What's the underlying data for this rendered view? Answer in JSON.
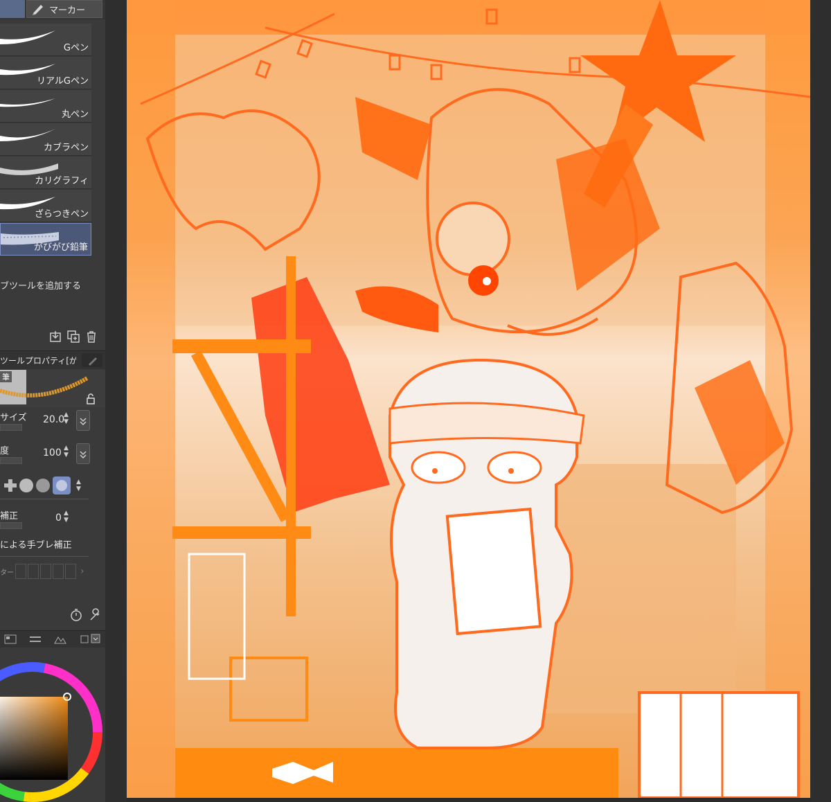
{
  "app": {
    "accent": "#7b8fc4"
  },
  "tabs": {
    "marker_label": "マーカー"
  },
  "brushes": [
    {
      "label": "Gペン",
      "stroke_color": "#ffffff"
    },
    {
      "label": "リアルGペン",
      "stroke_color": "#ffffff"
    },
    {
      "label": "丸ペン",
      "stroke_color": "#ffffff"
    },
    {
      "label": "カブラペン",
      "stroke_color": "#ffffff"
    },
    {
      "label": "カリグラフィ",
      "stroke_color": "#d0d0d0"
    },
    {
      "label": "ざらつきペン",
      "stroke_color": "#ffffff"
    },
    {
      "label": "がびがび鉛筆",
      "stroke_color": "#c8cfe0",
      "selected": true
    }
  ],
  "sub_tool": {
    "add_label": "ブツールを追加する"
  },
  "tool_property": {
    "header": "ツールプロパティ[が",
    "preview_tag": "筆",
    "size": {
      "label": "サイズ",
      "value": "20.0"
    },
    "density": {
      "label": "度",
      "value": "100"
    },
    "stabilization": {
      "label": "補正",
      "value": "0"
    },
    "speed_stabilization": {
      "label": "による手ブレ補正"
    },
    "color_row_label": "ター"
  },
  "canvas": {
    "dominant_color": "#ff8a1e"
  }
}
